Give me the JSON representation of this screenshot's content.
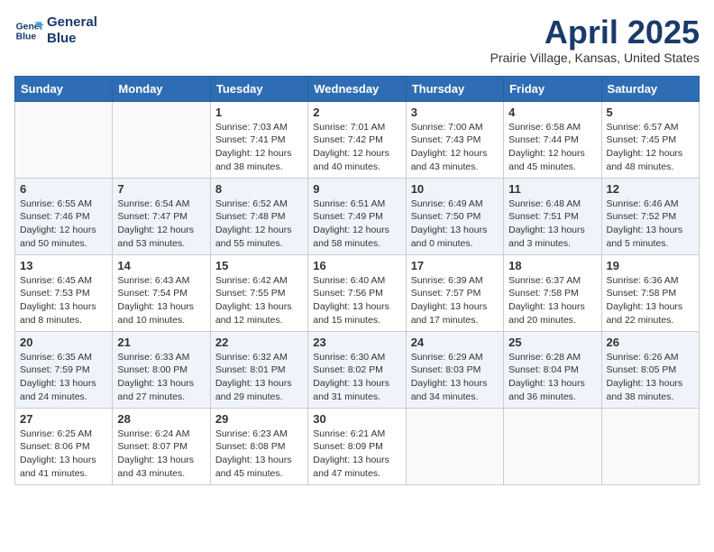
{
  "logo": {
    "line1": "General",
    "line2": "Blue"
  },
  "title": "April 2025",
  "subtitle": "Prairie Village, Kansas, United States",
  "days_of_week": [
    "Sunday",
    "Monday",
    "Tuesday",
    "Wednesday",
    "Thursday",
    "Friday",
    "Saturday"
  ],
  "weeks": [
    [
      {
        "day": "",
        "info": ""
      },
      {
        "day": "",
        "info": ""
      },
      {
        "day": "1",
        "info": "Sunrise: 7:03 AM\nSunset: 7:41 PM\nDaylight: 12 hours and 38 minutes."
      },
      {
        "day": "2",
        "info": "Sunrise: 7:01 AM\nSunset: 7:42 PM\nDaylight: 12 hours and 40 minutes."
      },
      {
        "day": "3",
        "info": "Sunrise: 7:00 AM\nSunset: 7:43 PM\nDaylight: 12 hours and 43 minutes."
      },
      {
        "day": "4",
        "info": "Sunrise: 6:58 AM\nSunset: 7:44 PM\nDaylight: 12 hours and 45 minutes."
      },
      {
        "day": "5",
        "info": "Sunrise: 6:57 AM\nSunset: 7:45 PM\nDaylight: 12 hours and 48 minutes."
      }
    ],
    [
      {
        "day": "6",
        "info": "Sunrise: 6:55 AM\nSunset: 7:46 PM\nDaylight: 12 hours and 50 minutes."
      },
      {
        "day": "7",
        "info": "Sunrise: 6:54 AM\nSunset: 7:47 PM\nDaylight: 12 hours and 53 minutes."
      },
      {
        "day": "8",
        "info": "Sunrise: 6:52 AM\nSunset: 7:48 PM\nDaylight: 12 hours and 55 minutes."
      },
      {
        "day": "9",
        "info": "Sunrise: 6:51 AM\nSunset: 7:49 PM\nDaylight: 12 hours and 58 minutes."
      },
      {
        "day": "10",
        "info": "Sunrise: 6:49 AM\nSunset: 7:50 PM\nDaylight: 13 hours and 0 minutes."
      },
      {
        "day": "11",
        "info": "Sunrise: 6:48 AM\nSunset: 7:51 PM\nDaylight: 13 hours and 3 minutes."
      },
      {
        "day": "12",
        "info": "Sunrise: 6:46 AM\nSunset: 7:52 PM\nDaylight: 13 hours and 5 minutes."
      }
    ],
    [
      {
        "day": "13",
        "info": "Sunrise: 6:45 AM\nSunset: 7:53 PM\nDaylight: 13 hours and 8 minutes."
      },
      {
        "day": "14",
        "info": "Sunrise: 6:43 AM\nSunset: 7:54 PM\nDaylight: 13 hours and 10 minutes."
      },
      {
        "day": "15",
        "info": "Sunrise: 6:42 AM\nSunset: 7:55 PM\nDaylight: 13 hours and 12 minutes."
      },
      {
        "day": "16",
        "info": "Sunrise: 6:40 AM\nSunset: 7:56 PM\nDaylight: 13 hours and 15 minutes."
      },
      {
        "day": "17",
        "info": "Sunrise: 6:39 AM\nSunset: 7:57 PM\nDaylight: 13 hours and 17 minutes."
      },
      {
        "day": "18",
        "info": "Sunrise: 6:37 AM\nSunset: 7:58 PM\nDaylight: 13 hours and 20 minutes."
      },
      {
        "day": "19",
        "info": "Sunrise: 6:36 AM\nSunset: 7:58 PM\nDaylight: 13 hours and 22 minutes."
      }
    ],
    [
      {
        "day": "20",
        "info": "Sunrise: 6:35 AM\nSunset: 7:59 PM\nDaylight: 13 hours and 24 minutes."
      },
      {
        "day": "21",
        "info": "Sunrise: 6:33 AM\nSunset: 8:00 PM\nDaylight: 13 hours and 27 minutes."
      },
      {
        "day": "22",
        "info": "Sunrise: 6:32 AM\nSunset: 8:01 PM\nDaylight: 13 hours and 29 minutes."
      },
      {
        "day": "23",
        "info": "Sunrise: 6:30 AM\nSunset: 8:02 PM\nDaylight: 13 hours and 31 minutes."
      },
      {
        "day": "24",
        "info": "Sunrise: 6:29 AM\nSunset: 8:03 PM\nDaylight: 13 hours and 34 minutes."
      },
      {
        "day": "25",
        "info": "Sunrise: 6:28 AM\nSunset: 8:04 PM\nDaylight: 13 hours and 36 minutes."
      },
      {
        "day": "26",
        "info": "Sunrise: 6:26 AM\nSunset: 8:05 PM\nDaylight: 13 hours and 38 minutes."
      }
    ],
    [
      {
        "day": "27",
        "info": "Sunrise: 6:25 AM\nSunset: 8:06 PM\nDaylight: 13 hours and 41 minutes."
      },
      {
        "day": "28",
        "info": "Sunrise: 6:24 AM\nSunset: 8:07 PM\nDaylight: 13 hours and 43 minutes."
      },
      {
        "day": "29",
        "info": "Sunrise: 6:23 AM\nSunset: 8:08 PM\nDaylight: 13 hours and 45 minutes."
      },
      {
        "day": "30",
        "info": "Sunrise: 6:21 AM\nSunset: 8:09 PM\nDaylight: 13 hours and 47 minutes."
      },
      {
        "day": "",
        "info": ""
      },
      {
        "day": "",
        "info": ""
      },
      {
        "day": "",
        "info": ""
      }
    ]
  ]
}
